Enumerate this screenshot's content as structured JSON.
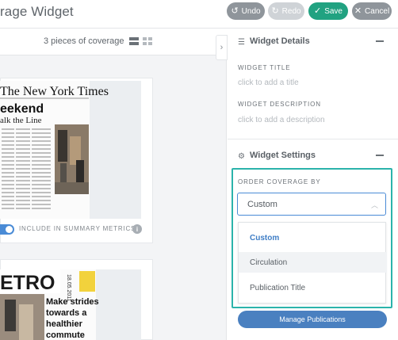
{
  "header": {
    "title": "rage Widget",
    "undo_label": "Undo",
    "redo_label": "Redo",
    "save_label": "Save",
    "cancel_label": "Cancel"
  },
  "coverage": {
    "count_text": "3 pieces of coverage",
    "summary_toggle_label": "INCLUDE IN SUMMARY METRICS",
    "summary_toggle_on": true,
    "clippings": [
      {
        "masthead": "The New York Times",
        "section": "eekend",
        "sub": "alk the Line"
      },
      {
        "masthead": "ETRO",
        "headline": "Make strides towards a healthier commute",
        "date": "18.05.2011"
      }
    ]
  },
  "widget_details": {
    "title": "Widget Details",
    "widget_title_label": "WIDGET TITLE",
    "widget_title_placeholder": "click to add a title",
    "widget_description_label": "WIDGET DESCRIPTION",
    "widget_description_placeholder": "click to add a description"
  },
  "widget_settings": {
    "title": "Widget Settings",
    "order_label": "ORDER COVERAGE BY",
    "order_value": "Custom",
    "order_options": [
      {
        "label": "Custom",
        "selected": true
      },
      {
        "label": "Circulation",
        "selected": false
      },
      {
        "label": "Publication Title",
        "selected": false
      }
    ],
    "manage_publications_label": "Manage Publications"
  },
  "colors": {
    "accent_blue": "#4a8bd6",
    "save_green": "#21a281",
    "highlight_teal": "#2bb3ab"
  }
}
